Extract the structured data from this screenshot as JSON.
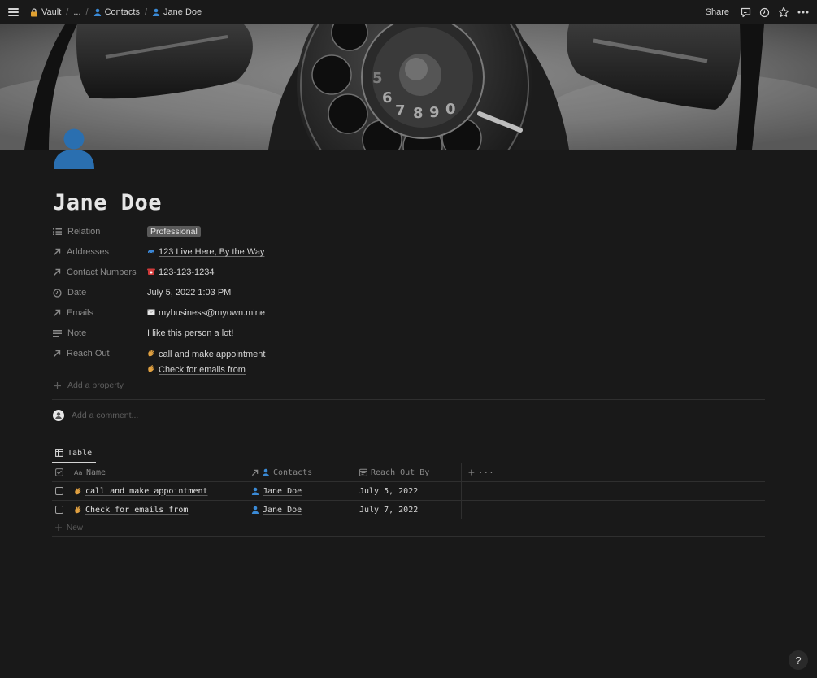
{
  "topbar": {
    "breadcrumbs": [
      {
        "label": "Vault"
      },
      {
        "label": "..."
      },
      {
        "label": "Contacts"
      },
      {
        "label": "Jane Doe"
      }
    ],
    "separator": "/",
    "share_label": "Share"
  },
  "page": {
    "title": "Jane Doe"
  },
  "properties": [
    {
      "label": "Relation",
      "value": "Professional"
    },
    {
      "label": "Addresses",
      "value": "123 Live Here, By the Way"
    },
    {
      "label": "Contact Numbers",
      "value": "123-123-1234"
    },
    {
      "label": "Date",
      "value": "July 5, 2022 1:03 PM"
    },
    {
      "label": "Emails",
      "value": "mybusiness@myown.mine"
    },
    {
      "label": "Note",
      "value": "I like this person a lot!"
    },
    {
      "label": "Reach Out",
      "values": [
        "call and make appointment",
        "Check for emails from"
      ]
    }
  ],
  "add_property_label": "Add a property",
  "comment_placeholder": "Add a comment...",
  "view": {
    "tab_label": "Table",
    "columns": [
      "Name",
      "Contacts",
      "Reach Out By"
    ],
    "rows": [
      {
        "name": "call and make appointment",
        "contact": "Jane Doe",
        "date": "July 5, 2022"
      },
      {
        "name": "Check for emails from",
        "contact": "Jane Doe",
        "date": "July 7, 2022"
      }
    ],
    "new_label": "New",
    "add_column_label": "+",
    "more_label": "···"
  },
  "help_label": "?",
  "colors": {
    "background": "#191919",
    "text": "#d4d4d4",
    "muted": "#8a8a8a",
    "tag": "#5a5a5a",
    "avatar_blue": "#2a6fb0"
  }
}
